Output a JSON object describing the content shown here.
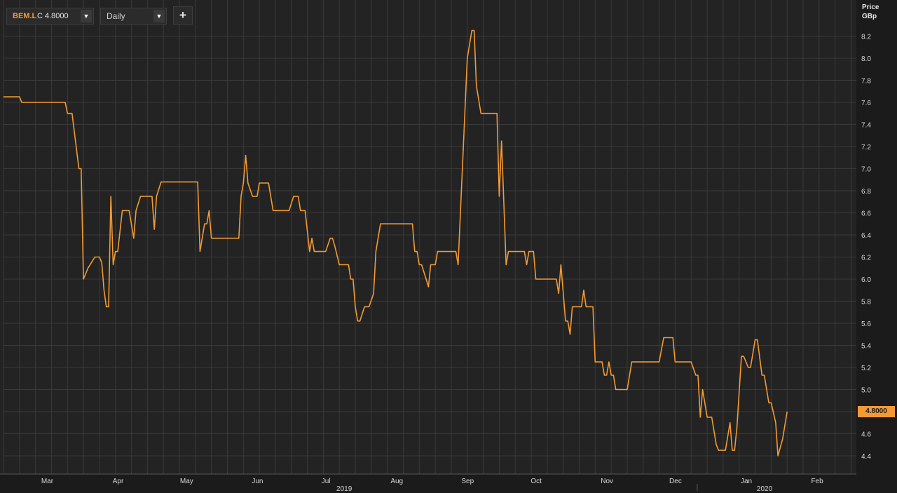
{
  "toolbar": {
    "symbol": "BEM.L",
    "close_text": "C 4.8000",
    "interval": "Daily",
    "add_label": "+",
    "dropdown_glyph": "▼"
  },
  "colors": {
    "series": "#f39a34",
    "background": "#232323",
    "grid": "#3a3a3a"
  },
  "chart_data": {
    "type": "line",
    "y_axis": {
      "title_line1": "Price",
      "title_line2": "GBp",
      "position": "right",
      "ylim": [
        4.3,
        8.4
      ],
      "ticks": [
        "4.4",
        "4.6",
        "4.8",
        "5.0",
        "5.2",
        "5.4",
        "5.6",
        "5.8",
        "6.0",
        "6.2",
        "6.4",
        "6.6",
        "6.8",
        "7.0",
        "7.2",
        "7.4",
        "7.6",
        "7.8",
        "8.0",
        "8.2"
      ]
    },
    "x_axis": {
      "month_labels": [
        "Mar",
        "Apr",
        "May",
        "Jun",
        "Jul",
        "Aug",
        "Sep",
        "Oct",
        "Nov",
        "Dec",
        "Jan",
        "Feb"
      ],
      "year_labels": [
        "2019",
        "2020"
      ],
      "start": "2019-02-22",
      "end": "2020-02-28"
    },
    "grid": true,
    "last_value_label": "4.8000",
    "series": [
      {
        "points": [
          [
            "2019-02-22",
            7.65
          ],
          [
            "2019-03-01",
            7.65
          ],
          [
            "2019-03-02",
            7.6
          ],
          [
            "2019-03-21",
            7.6
          ],
          [
            "2019-03-22",
            7.5
          ],
          [
            "2019-03-24",
            7.5
          ],
          [
            "2019-03-27",
            7.0
          ],
          [
            "2019-03-28",
            7.0
          ],
          [
            "2019-03-29",
            6.0
          ],
          [
            "2019-03-31",
            6.1
          ],
          [
            "2019-04-03",
            6.2
          ],
          [
            "2019-04-05",
            6.2
          ],
          [
            "2019-04-06",
            6.15
          ],
          [
            "2019-04-07",
            5.9
          ],
          [
            "2019-04-08",
            5.75
          ],
          [
            "2019-04-09",
            5.75
          ],
          [
            "2019-04-10",
            6.75
          ],
          [
            "2019-04-11",
            6.13
          ],
          [
            "2019-04-12",
            6.25
          ],
          [
            "2019-04-13",
            6.25
          ],
          [
            "2019-04-15",
            6.62
          ],
          [
            "2019-04-18",
            6.62
          ],
          [
            "2019-04-20",
            6.37
          ],
          [
            "2019-04-21",
            6.62
          ],
          [
            "2019-04-23",
            6.75
          ],
          [
            "2019-04-28",
            6.75
          ],
          [
            "2019-04-29",
            6.45
          ],
          [
            "2019-04-30",
            6.75
          ],
          [
            "2019-05-02",
            6.88
          ],
          [
            "2019-05-18",
            6.88
          ],
          [
            "2019-05-19",
            6.25
          ],
          [
            "2019-05-21",
            6.5
          ],
          [
            "2019-05-22",
            6.5
          ],
          [
            "2019-05-23",
            6.62
          ],
          [
            "2019-05-24",
            6.37
          ],
          [
            "2019-06-05",
            6.37
          ],
          [
            "2019-06-06",
            6.75
          ],
          [
            "2019-06-07",
            6.87
          ],
          [
            "2019-06-08",
            7.12
          ],
          [
            "2019-06-09",
            6.87
          ],
          [
            "2019-06-11",
            6.75
          ],
          [
            "2019-06-13",
            6.75
          ],
          [
            "2019-06-14",
            6.87
          ],
          [
            "2019-06-18",
            6.87
          ],
          [
            "2019-06-20",
            6.62
          ],
          [
            "2019-06-27",
            6.62
          ],
          [
            "2019-06-29",
            6.75
          ],
          [
            "2019-07-01",
            6.75
          ],
          [
            "2019-07-02",
            6.62
          ],
          [
            "2019-07-04",
            6.62
          ],
          [
            "2019-07-06",
            6.25
          ],
          [
            "2019-07-07",
            6.37
          ],
          [
            "2019-07-08",
            6.25
          ],
          [
            "2019-07-13",
            6.25
          ],
          [
            "2019-07-15",
            6.37
          ],
          [
            "2019-07-16",
            6.37
          ],
          [
            "2019-07-17",
            6.3
          ],
          [
            "2019-07-19",
            6.13
          ],
          [
            "2019-07-23",
            6.13
          ],
          [
            "2019-07-24",
            6.0
          ],
          [
            "2019-07-25",
            6.0
          ],
          [
            "2019-07-26",
            5.75
          ],
          [
            "2019-07-27",
            5.62
          ],
          [
            "2019-07-28",
            5.62
          ],
          [
            "2019-07-30",
            5.75
          ],
          [
            "2019-08-01",
            5.75
          ],
          [
            "2019-08-03",
            5.87
          ],
          [
            "2019-08-04",
            6.25
          ],
          [
            "2019-08-06",
            6.5
          ],
          [
            "2019-08-20",
            6.5
          ],
          [
            "2019-08-21",
            6.25
          ],
          [
            "2019-08-22",
            6.25
          ],
          [
            "2019-08-23",
            6.13
          ],
          [
            "2019-08-24",
            6.13
          ],
          [
            "2019-08-26",
            6.0
          ],
          [
            "2019-08-27",
            5.93
          ],
          [
            "2019-08-28",
            6.13
          ],
          [
            "2019-08-30",
            6.13
          ],
          [
            "2019-08-31",
            6.25
          ],
          [
            "2019-09-08",
            6.25
          ],
          [
            "2019-09-09",
            6.13
          ],
          [
            "2019-09-13",
            8.0
          ],
          [
            "2019-09-15",
            8.25
          ],
          [
            "2019-09-16",
            8.25
          ],
          [
            "2019-09-17",
            7.75
          ],
          [
            "2019-09-19",
            7.5
          ],
          [
            "2019-09-26",
            7.5
          ],
          [
            "2019-09-27",
            6.75
          ],
          [
            "2019-09-28",
            7.25
          ],
          [
            "2019-09-30",
            6.13
          ],
          [
            "2019-10-01",
            6.25
          ],
          [
            "2019-10-08",
            6.25
          ],
          [
            "2019-10-09",
            6.13
          ],
          [
            "2019-10-10",
            6.25
          ],
          [
            "2019-10-11",
            6.25
          ],
          [
            "2019-10-12",
            6.25
          ],
          [
            "2019-10-13",
            6.0
          ],
          [
            "2019-10-22",
            6.0
          ],
          [
            "2019-10-23",
            5.87
          ],
          [
            "2019-10-24",
            6.13
          ],
          [
            "2019-10-25",
            5.88
          ],
          [
            "2019-10-26",
            5.62
          ],
          [
            "2019-10-27",
            5.62
          ],
          [
            "2019-10-28",
            5.5
          ],
          [
            "2019-10-29",
            5.75
          ],
          [
            "2019-11-02",
            5.75
          ],
          [
            "2019-11-03",
            5.9
          ],
          [
            "2019-11-04",
            5.75
          ],
          [
            "2019-11-07",
            5.75
          ],
          [
            "2019-11-08",
            5.25
          ],
          [
            "2019-11-11",
            5.25
          ],
          [
            "2019-11-12",
            5.13
          ],
          [
            "2019-11-13",
            5.13
          ],
          [
            "2019-11-14",
            5.25
          ],
          [
            "2019-11-15",
            5.13
          ],
          [
            "2019-11-16",
            5.13
          ],
          [
            "2019-11-17",
            5.0
          ],
          [
            "2019-11-22",
            5.0
          ],
          [
            "2019-11-24",
            5.25
          ],
          [
            "2019-12-06",
            5.25
          ],
          [
            "2019-12-08",
            5.47
          ],
          [
            "2019-12-12",
            5.47
          ],
          [
            "2019-12-13",
            5.25
          ],
          [
            "2019-12-20",
            5.25
          ],
          [
            "2019-12-22",
            5.13
          ],
          [
            "2019-12-23",
            5.13
          ],
          [
            "2019-12-24",
            4.75
          ],
          [
            "2019-12-25",
            5.0
          ],
          [
            "2019-12-27",
            4.75
          ],
          [
            "2019-12-29",
            4.75
          ],
          [
            "2019-12-31",
            4.5
          ],
          [
            "2020-01-01",
            4.45
          ],
          [
            "2020-01-04",
            4.45
          ],
          [
            "2020-01-06",
            4.7
          ],
          [
            "2020-01-07",
            4.45
          ],
          [
            "2020-01-08",
            4.45
          ],
          [
            "2020-01-09",
            4.65
          ],
          [
            "2020-01-11",
            5.3
          ],
          [
            "2020-01-12",
            5.3
          ],
          [
            "2020-01-14",
            5.2
          ],
          [
            "2020-01-15",
            5.2
          ],
          [
            "2020-01-17",
            5.45
          ],
          [
            "2020-01-18",
            5.45
          ],
          [
            "2020-01-20",
            5.13
          ],
          [
            "2020-01-21",
            5.13
          ],
          [
            "2020-01-23",
            4.88
          ],
          [
            "2020-01-24",
            4.88
          ],
          [
            "2020-01-26",
            4.7
          ],
          [
            "2020-01-27",
            4.4
          ],
          [
            "2020-01-29",
            4.55
          ],
          [
            "2020-01-31",
            4.8
          ]
        ]
      }
    ]
  }
}
